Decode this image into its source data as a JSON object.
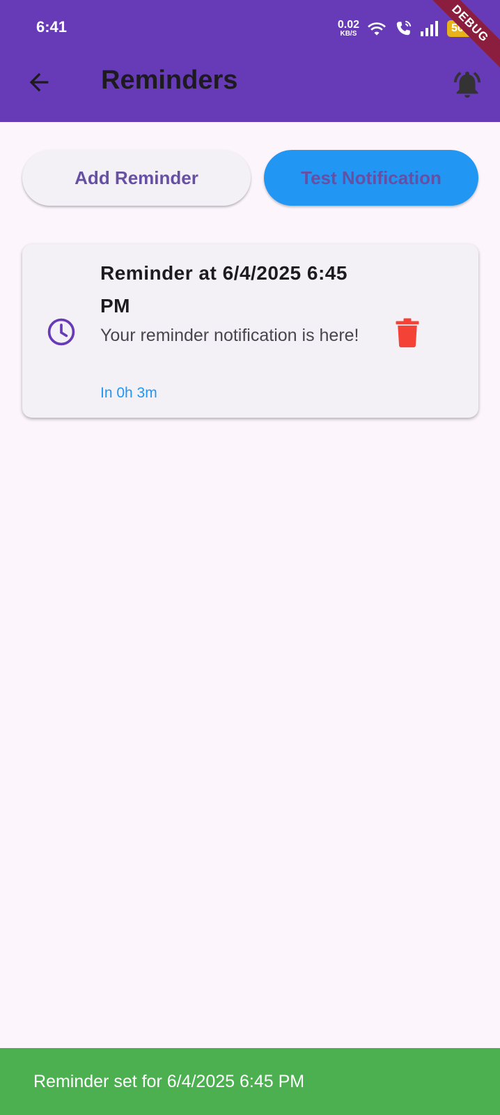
{
  "status_bar": {
    "time": "6:41",
    "net_speed_value": "0.02",
    "net_speed_unit": "KB/S",
    "battery": "50",
    "icons": [
      "wifi-icon",
      "wifi-call-icon",
      "signal-icon",
      "battery-icon"
    ]
  },
  "debug_banner": "DEBUG",
  "app_bar": {
    "title": "Reminders",
    "back_icon": "arrow-back-icon",
    "action_icon": "notifications-active-icon",
    "background": "#673ab7"
  },
  "actions": {
    "add_label": "Add Reminder",
    "test_label": "Test Notification",
    "test_color": "#2196f3"
  },
  "reminders": [
    {
      "title": "Reminder at 6/4/2025 6:45 PM",
      "body": "Your reminder notification is here!",
      "due_in": "In 0h 3m",
      "icon": "clock-icon",
      "delete_icon": "trash-icon"
    }
  ],
  "snackbar": {
    "message": "Reminder set for 6/4/2025 6:45 PM",
    "color": "#4caf50"
  },
  "colors": {
    "accent": "#6750a4",
    "delete": "#f44336",
    "page_background": "#fcf5fc"
  }
}
